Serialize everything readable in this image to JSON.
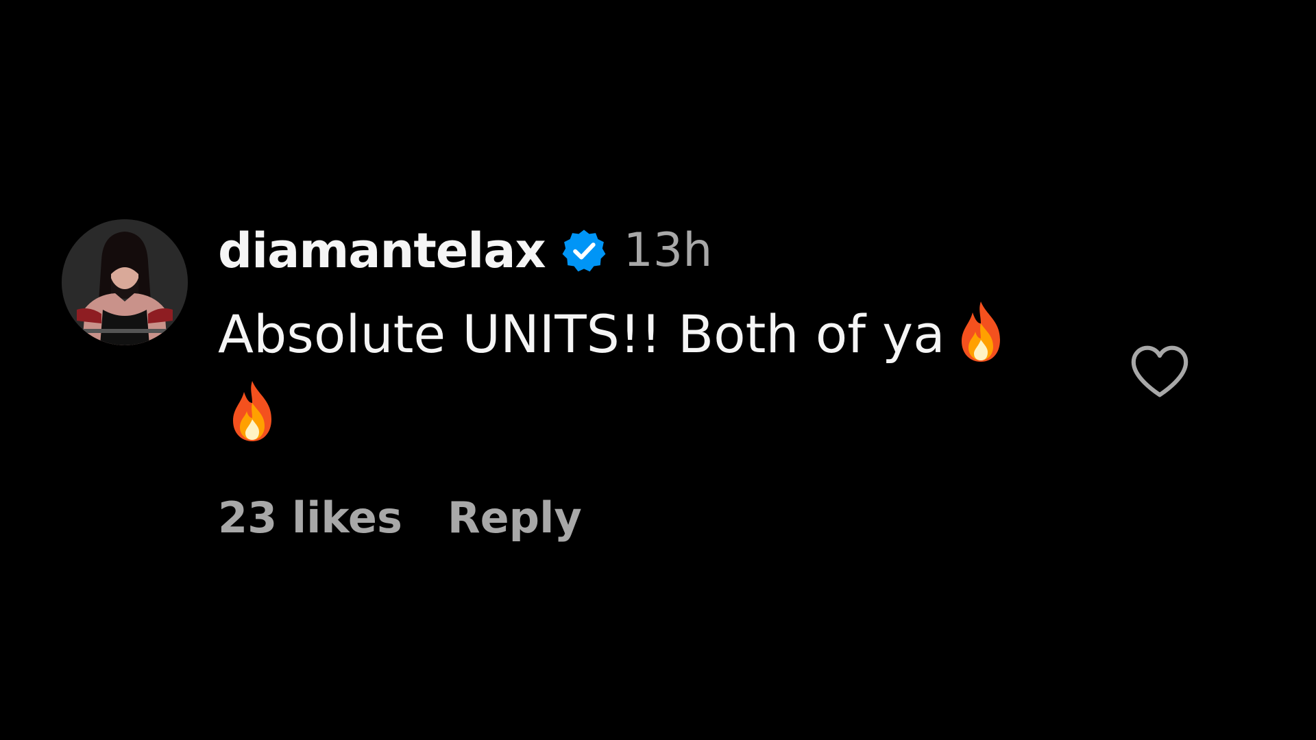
{
  "comment": {
    "username": "diamantelax",
    "verified_icon": "verified-badge-icon",
    "timestamp": "13h",
    "text": "Absolute UNITS!! Both of ya",
    "emojis": [
      "fire-emoji",
      "fire-emoji"
    ],
    "likes_label": "23 likes",
    "reply_label": "Reply",
    "like_icon": "heart-outline-icon"
  },
  "colors": {
    "background": "#000000",
    "primary_text": "#f5f5f5",
    "secondary_text": "#a8a8a8",
    "verified_blue": "#0095f6"
  }
}
